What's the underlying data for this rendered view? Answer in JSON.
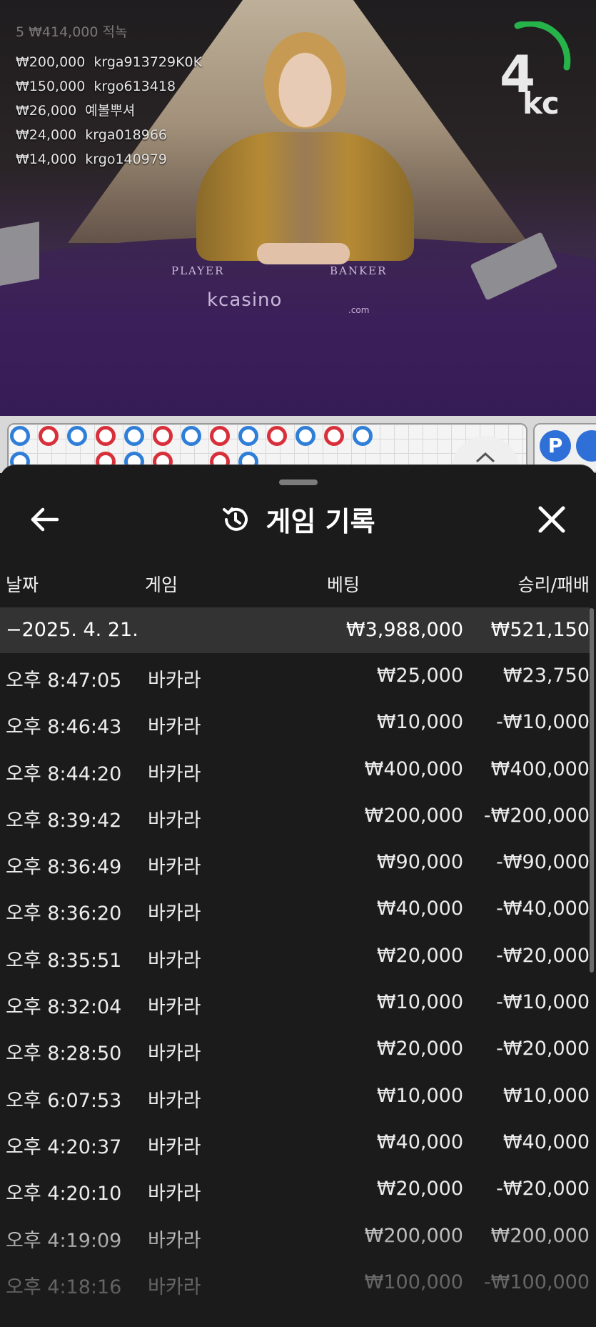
{
  "video": {
    "bettor_top": "5 ₩414,000 적녹",
    "bettors": [
      {
        "amount": "₩200,000",
        "user": "krga913729K0K"
      },
      {
        "amount": "₩150,000",
        "user": "krgo613418"
      },
      {
        "amount": "₩26,000",
        "user": "예볼뿌셔"
      },
      {
        "amount": "₩24,000",
        "user": "krga018966"
      },
      {
        "amount": "₩14,000",
        "user": "krgo140979"
      }
    ],
    "countdown": "4",
    "brand_logo": "kc",
    "table_player": "PLAYER",
    "table_banker": "BANKER",
    "table_logo": "kcasino",
    "table_logo_sub": ".com"
  },
  "road": {
    "prediction_player": "P",
    "colors": {
      "player": "#2f7fd8",
      "banker": "#d8303a"
    }
  },
  "history": {
    "title": "게임 기록",
    "columns": {
      "date": "날짜",
      "game": "게임",
      "bet": "베팅",
      "result": "승리/패배"
    },
    "date_group": {
      "date": "−2025. 4. 21.",
      "bet_total": "₩3,988,000",
      "result_total": "₩521,150"
    },
    "rows": [
      {
        "time": "오후 8:47:05",
        "game": "바카라",
        "bet": "₩25,000",
        "result": "₩23,750"
      },
      {
        "time": "오후 8:46:43",
        "game": "바카라",
        "bet": "₩10,000",
        "result": "-₩10,000"
      },
      {
        "time": "오후 8:44:20",
        "game": "바카라",
        "bet": "₩400,000",
        "result": "₩400,000"
      },
      {
        "time": "오후 8:39:42",
        "game": "바카라",
        "bet": "₩200,000",
        "result": "-₩200,000"
      },
      {
        "time": "오후 8:36:49",
        "game": "바카라",
        "bet": "₩90,000",
        "result": "-₩90,000"
      },
      {
        "time": "오후 8:36:20",
        "game": "바카라",
        "bet": "₩40,000",
        "result": "-₩40,000"
      },
      {
        "time": "오후 8:35:51",
        "game": "바카라",
        "bet": "₩20,000",
        "result": "-₩20,000"
      },
      {
        "time": "오후 8:32:04",
        "game": "바카라",
        "bet": "₩10,000",
        "result": "-₩10,000"
      },
      {
        "time": "오후 8:28:50",
        "game": "바카라",
        "bet": "₩20,000",
        "result": "-₩20,000"
      },
      {
        "time": "오후 6:07:53",
        "game": "바카라",
        "bet": "₩10,000",
        "result": "₩10,000"
      },
      {
        "time": "오후 4:20:37",
        "game": "바카라",
        "bet": "₩40,000",
        "result": "₩40,000"
      },
      {
        "time": "오후 4:20:10",
        "game": "바카라",
        "bet": "₩20,000",
        "result": "-₩20,000"
      },
      {
        "time": "오후 4:19:09",
        "game": "바카라",
        "bet": "₩200,000",
        "result": "₩200,000"
      },
      {
        "time": "오후 4:18:16",
        "game": "바카라",
        "bet": "₩100,000",
        "result": "-₩100,000"
      }
    ]
  }
}
